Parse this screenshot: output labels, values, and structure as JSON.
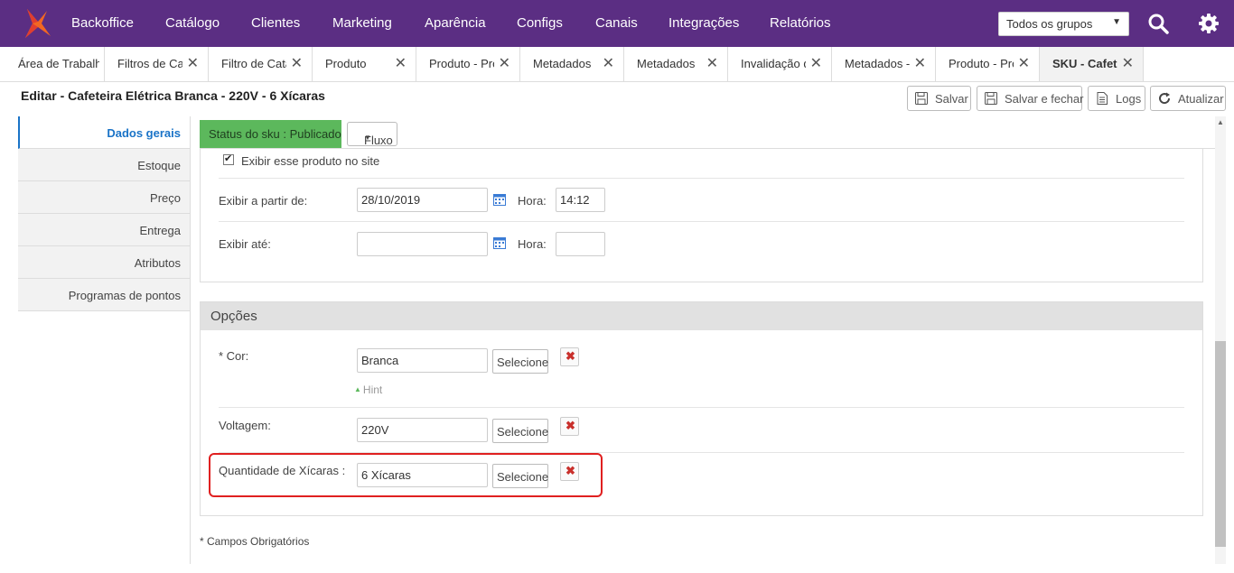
{
  "topnav": {
    "items": [
      "Backoffice",
      "Catálogo",
      "Clientes",
      "Marketing",
      "Aparência",
      "Configs",
      "Canais",
      "Integrações",
      "Relatórios"
    ],
    "group_select": "Todos os grupos",
    "icons": [
      "search-icon",
      "gear-icon"
    ],
    "brand_color": "#5b2e83"
  },
  "tabs": [
    {
      "label": "Área de Trabalho"
    },
    {
      "label": "Filtros de Catálogo"
    },
    {
      "label": "Filtro de Catálogo"
    },
    {
      "label": "Produto"
    },
    {
      "label": "Produto - Produto"
    },
    {
      "label": "Metadados"
    },
    {
      "label": "Metadados"
    },
    {
      "label": "Invalidação de"
    },
    {
      "label": "Metadados - C"
    },
    {
      "label": "Produto - Produto"
    },
    {
      "label": "SKU - Cafeteira"
    }
  ],
  "header": {
    "title": "Editar - Cafeteira Elétrica Branca - 220V - 6 Xícaras",
    "buttons": {
      "save": "Salvar",
      "save_close": "Salvar e fechar",
      "logs": "Logs",
      "refresh": "Atualizar"
    }
  },
  "sidenav": {
    "items": [
      "Dados gerais",
      "Estoque",
      "Preço",
      "Entrega",
      "Atributos",
      "Programas de pontos"
    ]
  },
  "status": {
    "label": "Status do sku : Publicado",
    "flow_button": "Fluxo",
    "color": "#5cb85c"
  },
  "visibility": {
    "show_on_site_label": "Exibir esse produto no site",
    "show_on_site_checked": true,
    "from_label": "Exibir a partir de:",
    "from_date": "28/10/2019",
    "from_time_label": "Hora:",
    "from_time": "14:12",
    "until_label": "Exibir até:",
    "until_date": "",
    "until_time_label": "Hora:",
    "until_time": ""
  },
  "options": {
    "title": "Opções",
    "select_label": "Selecione",
    "hint_label": "Hint",
    "rows": [
      {
        "label": "* Cor:",
        "value": "Branca"
      },
      {
        "label": "Voltagem:",
        "value": "220V"
      },
      {
        "label": "Quantidade de Xícaras :",
        "value": "6 Xícaras"
      }
    ]
  },
  "footer": {
    "required_note": "* Campos Obrigatórios"
  }
}
